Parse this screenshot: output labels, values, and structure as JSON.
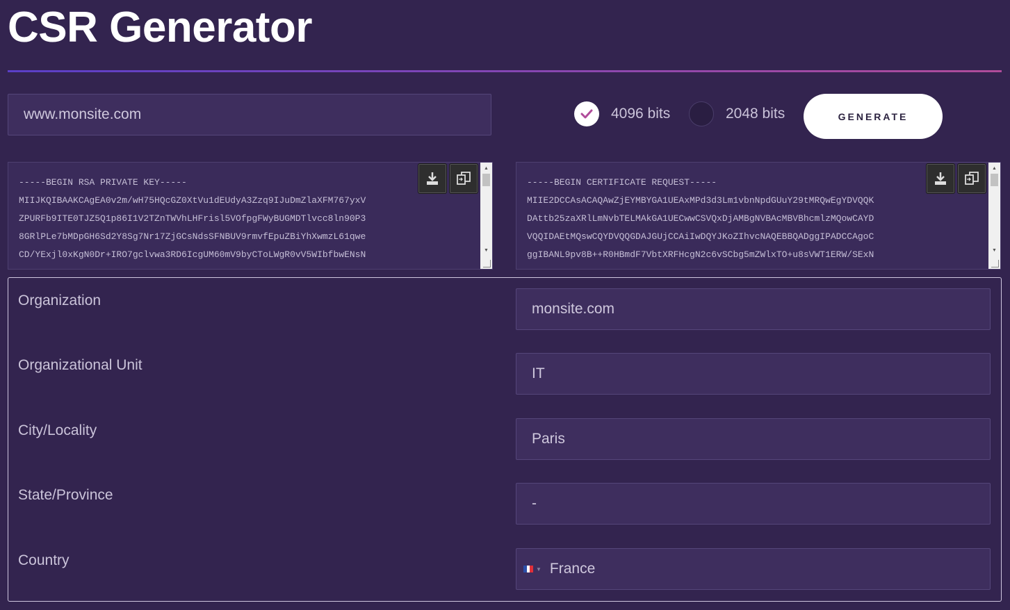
{
  "header": {
    "title": "CSR Generator"
  },
  "domain_input": {
    "value": "www.monsite.com"
  },
  "key_size": {
    "options": [
      {
        "label": "4096 bits",
        "checked": true
      },
      {
        "label": "2048 bits",
        "checked": false
      }
    ]
  },
  "generate_button": {
    "label": "GENERATE"
  },
  "private_key": {
    "text": "-----BEGIN RSA PRIVATE KEY-----\nMIIJKQIBAAKCAgEA0v2m/wH75HQcGZ0XtVu1dEUdyA3Zzq9IJuDmZlaXFM767yxV\nZPURFb9ITE0TJZ5Q1p86I1V2TZnTWVhLHFrisl5VOfpgFWyBUGMDTlvcc8ln90P3\n8GRlPLe7bMDpGH6Sd2Y8Sg7Nr17ZjGCsNdsSFNBUV9rmvfEpuZBiYhXwmzL61qwe\nCD/YExjl0xKgN0Dr+IRO7gclvwa3RD6IcgUM60mV9byCToLWgR0vV5WIbfbwENsN"
  },
  "csr": {
    "text": "-----BEGIN CERTIFICATE REQUEST-----\nMIIE2DCCAsACAQAwZjEYMBYGA1UEAxMPd3d3Lm1vbnNpdGUuY29tMRQwEgYDVQQK\nDAttb25zaXRlLmNvbTELMAkGA1UECwwCSVQxDjAMBgNVBAcMBVBhcmlzMQowCAYD\nVQQIDAEtMQswCQYDVQQGDAJGUjCCAiIwDQYJKoZIhvcNAQEBBQADggIPADCCAgoC\nggIBANL9pv8B++R0HBmdF7VbtXRFHcgN2c6vSCbg5mZWlxTO+u8sVWT1ERW/SExN"
  },
  "form": {
    "fields": [
      {
        "label": "Organization",
        "value": "monsite.com"
      },
      {
        "label": "Organizational Unit",
        "value": "IT"
      },
      {
        "label": "City/Locality",
        "value": "Paris"
      },
      {
        "label": "State/Province",
        "value": "-"
      },
      {
        "label": "Country",
        "value": "France"
      }
    ]
  },
  "colors": {
    "background": "#33244f",
    "input_bg": "#3e2e5e",
    "accent": "#b04c9a",
    "check": "#b04c9a"
  },
  "icons": {
    "download": "download-icon",
    "copy": "copy-icon",
    "check": "check-icon",
    "flag": "france-flag-icon"
  }
}
